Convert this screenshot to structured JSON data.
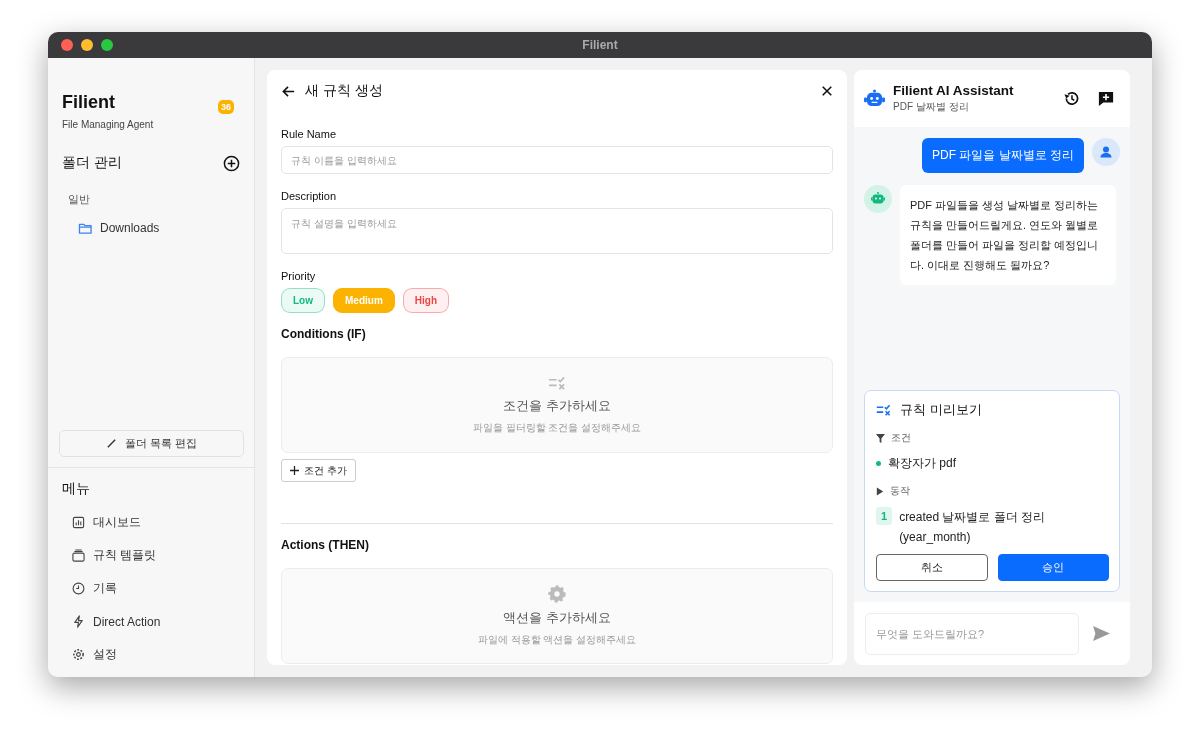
{
  "window": {
    "title": "Filient"
  },
  "sidebar": {
    "app_name": "Filient",
    "tagline": "File Managing Agent",
    "badge": "36",
    "folders_heading": "폴더 관리",
    "folder_group": "일반",
    "folders": [
      {
        "label": "Downloads"
      }
    ],
    "edit_button": "폴더 목록 편집",
    "menu_heading": "메뉴",
    "menu": [
      {
        "label": "대시보드"
      },
      {
        "label": "규칙 템플릿"
      },
      {
        "label": "기록"
      },
      {
        "label": "Direct Action"
      },
      {
        "label": "설정"
      }
    ]
  },
  "editor": {
    "title": "새 규칙 생성",
    "rule_name": {
      "label": "Rule Name",
      "placeholder": "규칙 이름을 입력하세요"
    },
    "description": {
      "label": "Description",
      "placeholder": "규칙 설명을 입력하세요"
    },
    "priority": {
      "label": "Priority",
      "options": [
        {
          "label": "Low",
          "selected": false,
          "color": "#10b981"
        },
        {
          "label": "Medium",
          "selected": true,
          "color": "#fbb300"
        },
        {
          "label": "High",
          "selected": false,
          "color": "#ef4444"
        }
      ]
    },
    "conditions": {
      "heading": "Conditions (IF)",
      "empty_title": "조건을 추가하세요",
      "empty_hint": "파일을 필터링할 조건을 설정해주세요",
      "add_button": "조건 추가"
    },
    "actions": {
      "heading": "Actions (THEN)",
      "empty_title": "액션을 추가하세요",
      "empty_hint": "파일에 적용할 액션을 설정해주세요"
    }
  },
  "assistant": {
    "title": "Filient AI Assistant",
    "subtitle": "PDF 날짜별 정리",
    "messages": [
      {
        "kind": "user",
        "text": "PDF 파일을 날짜별로 정리"
      },
      {
        "kind": "assistant",
        "text": "PDF 파일들을 생성 날짜별로 정리하는 규칙을 만들어드릴게요. 연도와 월별로 폴더를 만들어 파일을 정리할 예정입니다. 이대로 진행해도 될까요?"
      }
    ],
    "preview": {
      "title": "규칙 미리보기",
      "conditions_label": "조건",
      "conditions": [
        {
          "text": "확장자가 pdf",
          "color": "#10b981"
        }
      ],
      "actions_label": "동작",
      "actions": [
        {
          "number": "1",
          "text": "created 날짜별로 폴더 정리 (year_month)"
        }
      ],
      "cancel_button": "취소",
      "approve_button": "승인"
    },
    "input": {
      "placeholder": "무엇을 도와드릴까요?"
    }
  }
}
